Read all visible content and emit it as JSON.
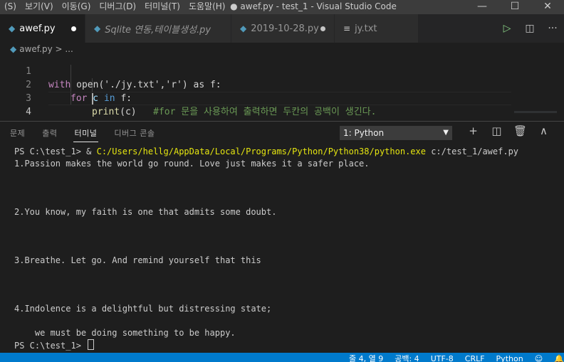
{
  "menu": [
    "(S)",
    "보기(V)",
    "이동(G)",
    "디버그(D)",
    "터미널(T)",
    "도움말(H)"
  ],
  "window_title": "● awef.py - test_1 - Visual Studio Code",
  "window_controls": {
    "minimize": "—",
    "maximize": "☐",
    "close": "✕"
  },
  "tabs": [
    {
      "label": "awef.py",
      "icon": "python-icon",
      "active": true,
      "dirty": true
    },
    {
      "label": "Sqlite 연동,테이블생성.py",
      "icon": "python-icon",
      "active": false,
      "dirty": false
    },
    {
      "label": "2019-10-28.py",
      "icon": "python-icon",
      "active": false,
      "dirty": true
    },
    {
      "label": "jy.txt",
      "icon": "text-file-icon",
      "active": false,
      "dirty": false
    }
  ],
  "editor_actions": {
    "run": "▷",
    "split": "◫",
    "more": "···"
  },
  "breadcrumb": {
    "file": "awef.py",
    "rest": "> ..."
  },
  "editor": {
    "line_numbers": [
      "1",
      "2",
      "3",
      "4"
    ],
    "line1": {
      "kw": "with",
      "rest": " open('./jy.txt','r') as f:"
    },
    "line2": {
      "kw": "for",
      "var": " c ",
      "kw2": "in",
      "rest": " f:"
    },
    "line3": {
      "fn": "print",
      "arg": "(c)",
      "comment": "#for 문을 사용하여 출력하면 두칸의 공백이 생긴다."
    }
  },
  "panel": {
    "tabs": [
      "문제",
      "출력",
      "터미널",
      "디버그 콘솔"
    ],
    "active_tab": "터미널",
    "terminal_select": "1: Python",
    "select_arrow": "▼",
    "actions": {
      "add": "+",
      "split": "◫",
      "trash": "🗑",
      "maximize": "∧",
      "close": "✕"
    }
  },
  "terminal": {
    "prompt1": "PS C:\\test_1> & ",
    "exe_path": "C:/Users/hellg/AppData/Local/Programs/Python/Python38/python.exe",
    "script_arg": " c:/test_1/awef.py",
    "lines": [
      "1.Passion makes the world go round. Love just makes it a safer place.",
      "2.You know, my faith is one that admits some doubt.",
      "3.Breathe. Let go. And remind yourself that this",
      "4.Indolence is a delightful but distressing state;",
      "    we must be doing something to be happy."
    ],
    "prompt2": "PS C:\\test_1> "
  },
  "statusbar": {
    "position": "줄 4, 열 9",
    "spaces": "공백: 4",
    "encoding": "UTF-8",
    "eol": "CRLF",
    "language": "Python",
    "feedback": "☺",
    "bell": "🔔"
  },
  "colors": {
    "accent": "#007acc",
    "editor_bg": "#1e1e1e",
    "keyword": "#c586c0",
    "comment": "#6a9955",
    "terminal_path": "#e5e510"
  }
}
